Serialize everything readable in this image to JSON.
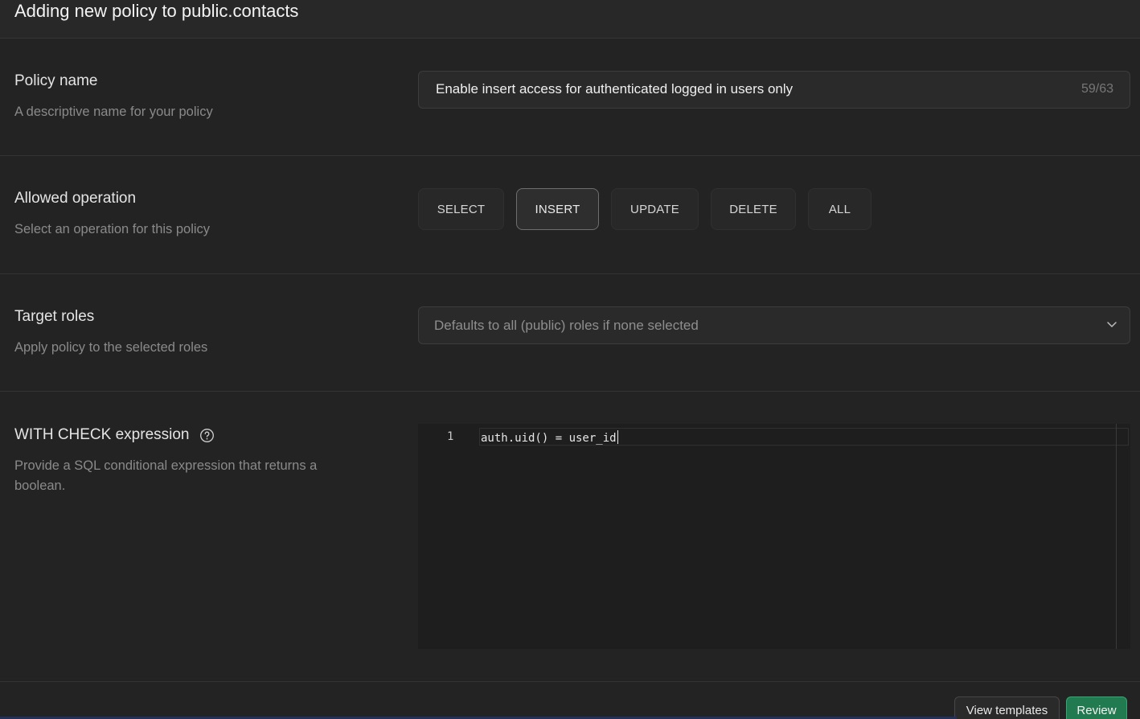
{
  "header": {
    "title": "Adding new policy to public.contacts"
  },
  "policy_name": {
    "title": "Policy name",
    "description": "A descriptive name for your policy",
    "value": "Enable insert access for authenticated logged in users only",
    "counter": "59/63"
  },
  "allowed_operation": {
    "title": "Allowed operation",
    "description": "Select an operation for this policy",
    "operations": [
      "SELECT",
      "INSERT",
      "UPDATE",
      "DELETE",
      "ALL"
    ],
    "selected": "INSERT"
  },
  "target_roles": {
    "title": "Target roles",
    "description": "Apply policy to the selected roles",
    "placeholder": "Defaults to all (public) roles if none selected"
  },
  "with_check": {
    "title": "WITH CHECK expression",
    "description": "Provide a SQL conditional expression that returns a boolean.",
    "line_number": "1",
    "code": "auth.uid() = user_id"
  },
  "footer": {
    "templates_label": "View templates",
    "review_label": "Review"
  },
  "colors": {
    "background": "#232323",
    "review_button": "#227a50",
    "review_border": "#3aa574"
  }
}
